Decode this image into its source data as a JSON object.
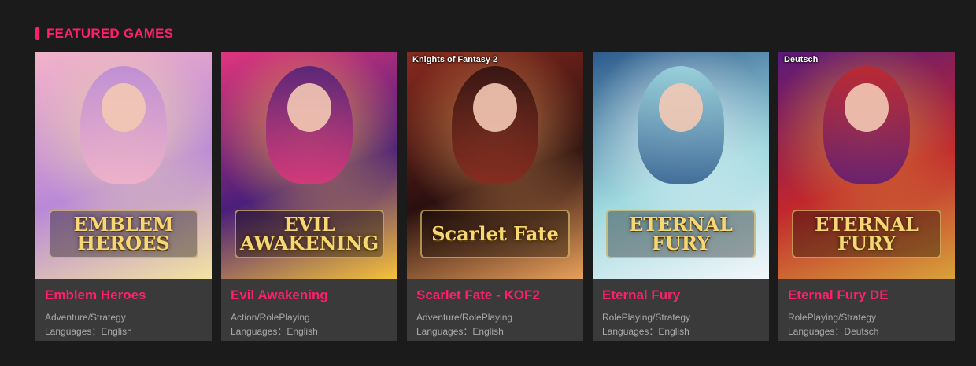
{
  "section": {
    "title": "FEATURED GAMES"
  },
  "colors": {
    "accent": "#ff1f6b",
    "background": "#1b1b1b",
    "card": "#3a3a3a",
    "meta_text": "#a9a9a9"
  },
  "cards": [
    {
      "title": "Emblem Heroes",
      "genre": "Adventure/Strategy",
      "languages_label": "Languages：",
      "languages": "English",
      "tag": "",
      "logo_text": "EMBLEM HEROES",
      "palette": [
        "#f4b3c9",
        "#b989d8",
        "#f2e3a0"
      ]
    },
    {
      "title": "Evil Awakening",
      "genre": "Action/RolePlaying",
      "languages_label": "Languages：",
      "languages": "English",
      "tag": "",
      "logo_text": "EVIL AWAKENING",
      "palette": [
        "#e0357d",
        "#4a1f7a",
        "#f5c23a"
      ]
    },
    {
      "title": "Scarlet Fate - KOF2",
      "genre": "Adventure/RolePlaying",
      "languages_label": "Languages：",
      "languages": "English",
      "tag": "Knights of Fantasy 2",
      "logo_text": "Scarlet Fate",
      "palette": [
        "#8a2a1e",
        "#2a0f0f",
        "#e8a05a"
      ]
    },
    {
      "title": "Eternal Fury",
      "genre": "RolePlaying/Strategy",
      "languages_label": "Languages：",
      "languages": "English",
      "tag": "",
      "logo_text": "ETERNAL FURY",
      "palette": [
        "#2d5a8c",
        "#9fd9df",
        "#f4f7fb"
      ]
    },
    {
      "title": "Eternal Fury DE",
      "genre": "RolePlaying/Strategy",
      "languages_label": "Languages：",
      "languages": "Deutsch",
      "tag": "Deutsch",
      "logo_text": "ETERNAL FURY",
      "palette": [
        "#5a1a7a",
        "#c1272d",
        "#d8a23a"
      ]
    }
  ]
}
